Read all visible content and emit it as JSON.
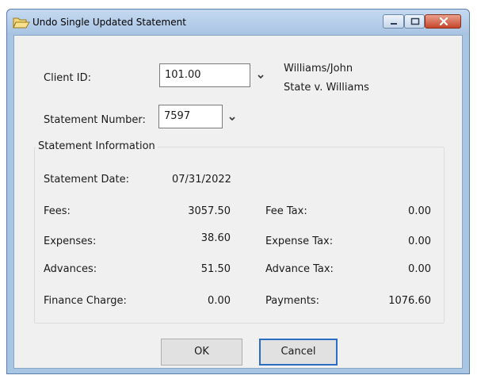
{
  "window": {
    "title": "Undo Single Updated Statement"
  },
  "form": {
    "client_id_label": "Client ID:",
    "client_id_value": "101.00",
    "client_name": "Williams/John",
    "case_name": "State v. Williams",
    "statement_number_label": "Statement Number:",
    "statement_number_value": "7597"
  },
  "group": {
    "title": "Statement Information",
    "statement_date_label": "Statement Date:",
    "statement_date_value": "07/31/2022",
    "fees_label": "Fees:",
    "fees_value": "3057.50",
    "fee_tax_label": "Fee Tax:",
    "fee_tax_value": "0.00",
    "expenses_label": "Expenses:",
    "expenses_value": "38.60",
    "expense_tax_label": "Expense Tax:",
    "expense_tax_value": "0.00",
    "advances_label": "Advances:",
    "advances_value": "51.50",
    "advance_tax_label": "Advance Tax:",
    "advance_tax_value": "0.00",
    "finance_charge_label": "Finance Charge:",
    "finance_charge_value": "0.00",
    "payments_label": "Payments:",
    "payments_value": "1076.60"
  },
  "buttons": {
    "ok_label": "OK",
    "cancel_label": "Cancel"
  },
  "colors": {
    "accent": "#2b6cc4",
    "close": "#c7462b",
    "frame": "#a9c5e4"
  },
  "icons": {
    "title_icon": "folder-open-icon",
    "dropdown": "chevron-down-icon"
  }
}
